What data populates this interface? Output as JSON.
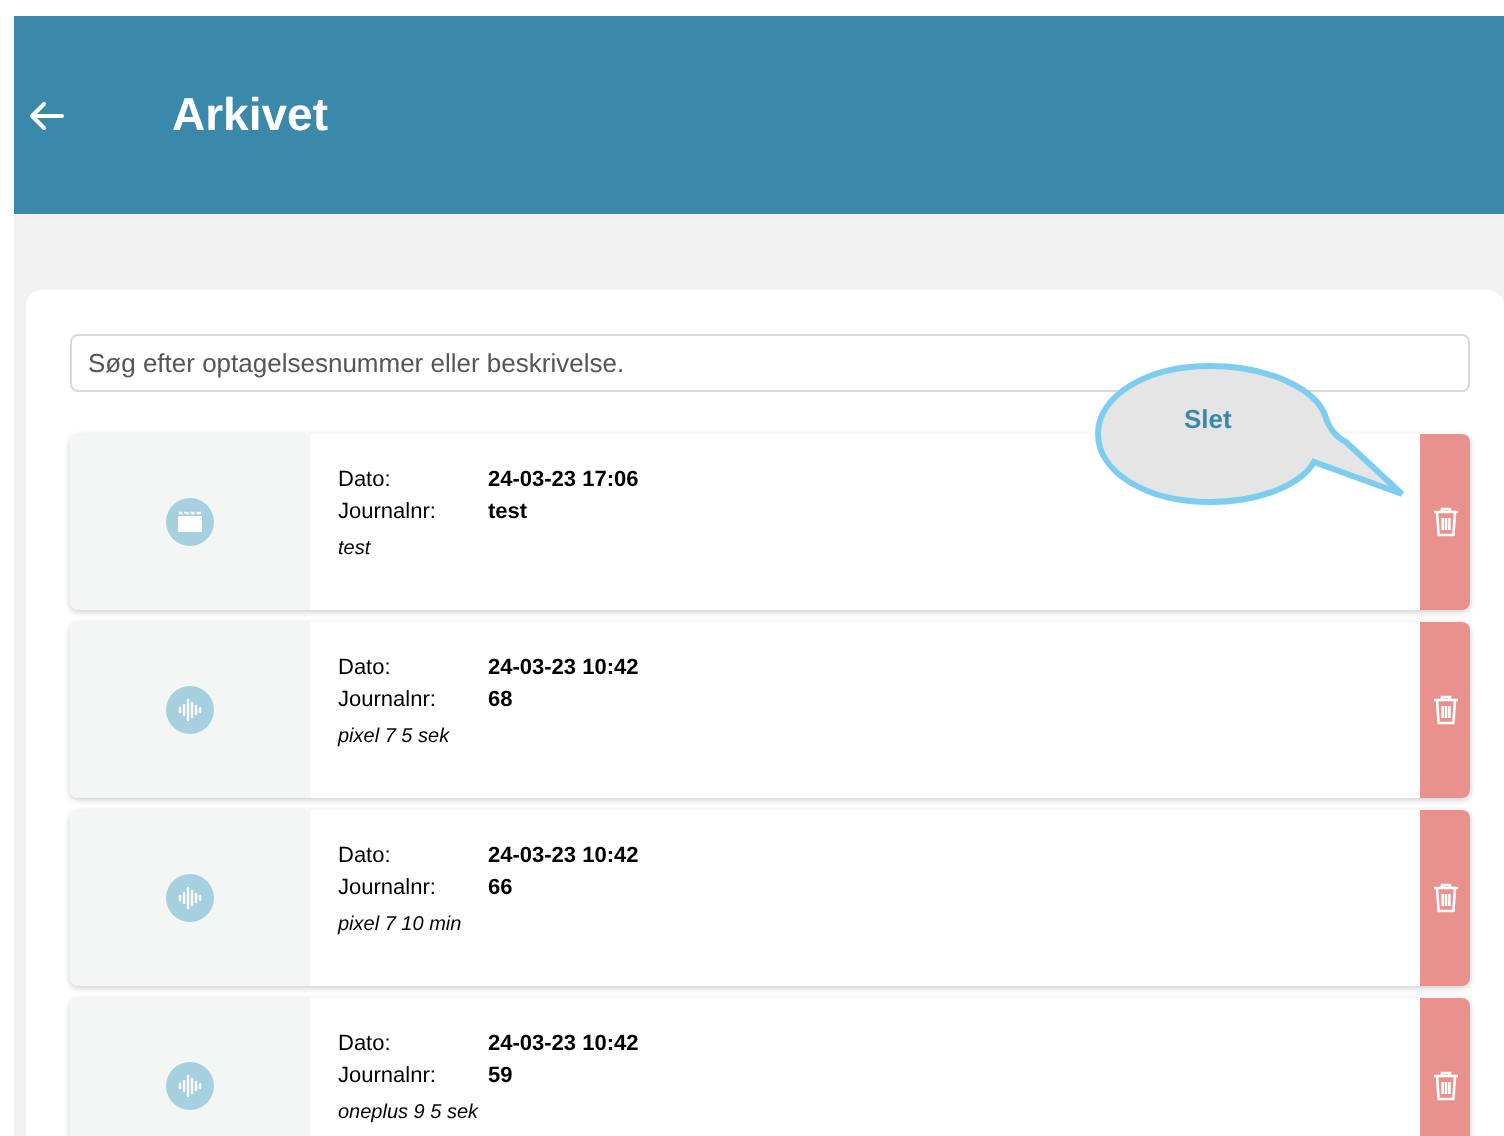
{
  "header": {
    "title": "Arkivet"
  },
  "search": {
    "placeholder": "Søg efter optagelsesnummer eller beskrivelse."
  },
  "tooltip": {
    "text": "Slet"
  },
  "recordings": [
    {
      "kind": "video",
      "date_label": "Dato:",
      "date": "24-03-23 17:06",
      "journal_label": "Journalnr:",
      "journal": "test",
      "description": "test"
    },
    {
      "kind": "audio",
      "date_label": "Dato:",
      "date": "24-03-23 10:42",
      "journal_label": "Journalnr:",
      "journal": "68",
      "description": "pixel 7 5 sek"
    },
    {
      "kind": "audio",
      "date_label": "Dato:",
      "date": "24-03-23 10:42",
      "journal_label": "Journalnr:",
      "journal": "66",
      "description": "pixel 7 10 min"
    },
    {
      "kind": "audio",
      "date_label": "Dato:",
      "date": "24-03-23 10:42",
      "journal_label": "Journalnr:",
      "journal": "59",
      "description": "oneplus 9 5 sek"
    }
  ]
}
